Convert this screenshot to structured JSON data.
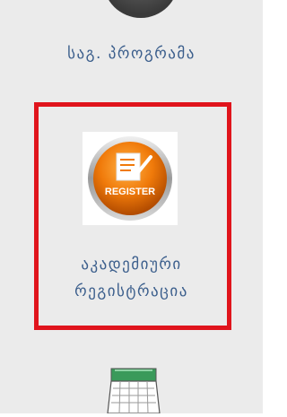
{
  "menu": {
    "items": [
      {
        "label": "საგ. პროგრამა",
        "icon": "circle-icon"
      },
      {
        "label_line1": "აკადემიური",
        "label_line2": "რეგისტრაცია",
        "icon": "register-icon",
        "icon_text": "REGISTER",
        "highlighted": true
      },
      {
        "icon": "calendar-icon"
      }
    ]
  },
  "colors": {
    "label": "#3b5e8c",
    "highlight": "#e0141c",
    "register_orange": "#f07a0a",
    "calendar_green": "#3a9a5a"
  }
}
